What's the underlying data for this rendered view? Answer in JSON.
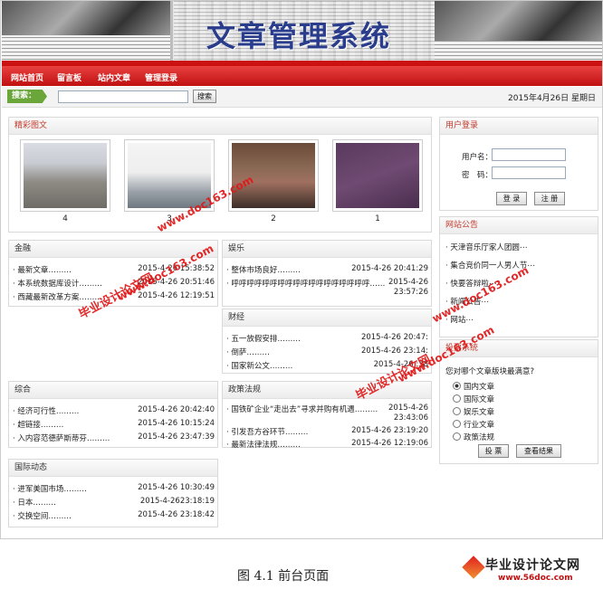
{
  "banner": {
    "title": "文章管理系统"
  },
  "nav": {
    "items": [
      "网站首页",
      "留言板",
      "站内文章",
      "管理登录"
    ]
  },
  "search": {
    "label": "搜索：",
    "button": "搜索",
    "placeholder": ""
  },
  "date": "2015年4月26日 星期日",
  "gallery": {
    "title": "精彩图文",
    "captions": [
      "4",
      "3",
      "2",
      "1"
    ]
  },
  "finance": {
    "title": "金融",
    "items": [
      {
        "t": "· 最新文章………",
        "d": ""
      },
      {
        "t": "· 本系统数据库设计………",
        "d": "2015-4-26 20:51:46"
      },
      {
        "t": "· 西藏最新改革方案………",
        "d": "2015-4-26 12:19:51"
      }
    ],
    "first_date": "2015-4-26 15:38:52"
  },
  "entertainment": {
    "title": "娱乐",
    "items": [
      {
        "t": "· 整体市场良好………",
        "d": "2015-4-26 20:41:29"
      },
      {
        "t": "· 呼呼呼呼呼呼呼呼呼呼呼呼呼呼呼呼呼呼………",
        "d": "2015-4-26 23:57:26"
      }
    ]
  },
  "economy": {
    "title": "财经",
    "items": [
      {
        "t": "· 五一放假安排………",
        "d": "2015-4-26 20:47:"
      },
      {
        "t": "· 倒萨………",
        "d": "2015-4-26 23:14:"
      },
      {
        "t": "· 国家新公文………",
        "d": "2015-4-26 :38"
      }
    ]
  },
  "general": {
    "title": "综合",
    "items": [
      {
        "t": "· 经济可行性………",
        "d": "2015-4-26 20:42:40"
      },
      {
        "t": "· 超链接………",
        "d": "2015-4-26 10:15:24"
      },
      {
        "t": "· 入内容范德萨斯蒂芬………",
        "d": "2015-4-26 23:47:39"
      }
    ]
  },
  "policy": {
    "title": "政策法规",
    "items": [
      {
        "t": "· 国铁矿企业“走出去”寻求并购有机遇………",
        "d": "2015-4-26 23:43:06"
      },
      {
        "t": "· 引发吾方谷环节………",
        "d": "2015-4-26 23:19:20"
      },
      {
        "t": "· 最新法律法规………",
        "d": "2015-4-26 12:19:06"
      }
    ]
  },
  "international": {
    "title": "国际动态",
    "items": [
      {
        "t": "· 进军美国市场………",
        "d": "2015-4-26 10:30:49"
      },
      {
        "t": "· 日本………",
        "d": "2015-4-2623:18:19"
      },
      {
        "t": "· 交换空间………",
        "d": "2015-4-26 23:18:42"
      }
    ]
  },
  "login": {
    "title": "用户登录",
    "user_label": "用户名：",
    "pass_label": "密　码：",
    "login": "登 录",
    "register": "注 册"
  },
  "notice": {
    "title": "网站公告",
    "items": [
      "天津音乐厅家人团圆⋯",
      "集合竞价同一人男人节⋯",
      "快要答辩啦⋯",
      "新闻公告⋯",
      "网站⋯"
    ]
  },
  "vote": {
    "title": "投票系统",
    "question": "您对哪个文章版块最满意?",
    "options": [
      "国内文章",
      "国际文章",
      "娱乐文章",
      "行业文章",
      "政策法规"
    ],
    "selected": 0,
    "vote": "投 票",
    "results": "查看结果"
  },
  "watermark": [
    "毕业设计论文网",
    "www.doc163.com"
  ],
  "caption": "图 4.1  前台页面",
  "logo": {
    "name": "毕业设计论文网",
    "url": "www.56doc.com"
  }
}
